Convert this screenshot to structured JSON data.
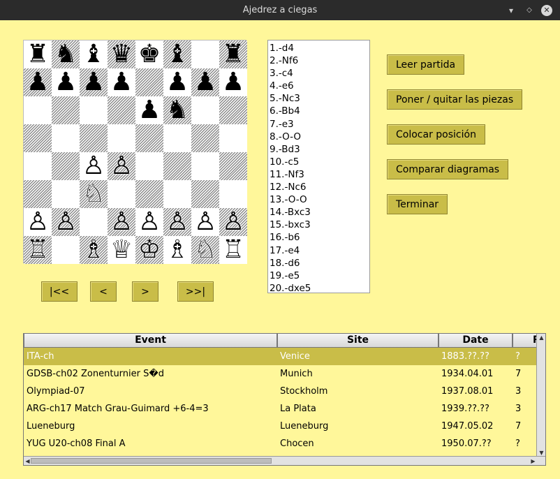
{
  "window": {
    "title": "Ajedrez a ciegas"
  },
  "board": [
    [
      "♜",
      "♞",
      "♝",
      "♛",
      "♚",
      "♝",
      "",
      "♜"
    ],
    [
      "♟",
      "♟",
      "♟",
      "♟",
      "",
      "♟",
      "♟",
      "♟"
    ],
    [
      "",
      "",
      "",
      "",
      "♟",
      "♞",
      "",
      ""
    ],
    [
      "",
      "",
      "",
      "",
      "",
      "",
      "",
      ""
    ],
    [
      "",
      "",
      "♙",
      "♙",
      "",
      "",
      "",
      ""
    ],
    [
      "",
      "",
      "♘",
      "",
      "",
      "",
      "",
      ""
    ],
    [
      "♙",
      "♙",
      "",
      "♙",
      "♙",
      "♙",
      "♙",
      "♙"
    ],
    [
      "♖",
      "",
      "♗",
      "♕",
      "♔",
      "♗",
      "♘",
      "♖"
    ]
  ],
  "nav": {
    "first": "|<<",
    "prev": "<",
    "next": ">",
    "last": ">>|"
  },
  "moves": [
    "1.-d4",
    "2.-Nf6",
    "3.-c4",
    "4.-e6",
    "5.-Nc3",
    "6.-Bb4",
    "7.-e3",
    "8.-O-O",
    "9.-Bd3",
    "10.-c5",
    "11.-Nf3",
    "12.-Nc6",
    "13.-O-O",
    "14.-Bxc3",
    "15.-bxc3",
    "16.-b6",
    "17.-e4",
    "18.-d6",
    "19.-e5",
    "20.-dxe5"
  ],
  "actions": {
    "read": "Leer partida",
    "toggle_pieces": "Poner / quitar las piezas",
    "set_position": "Colocar posición",
    "compare": "Comparar diagramas",
    "finish": "Terminar"
  },
  "table": {
    "headers": [
      "Event",
      "Site",
      "Date",
      "R"
    ],
    "rows": [
      [
        "ITA-ch",
        "Venice",
        "1883.??.??",
        "?"
      ],
      [
        "GDSB-ch02 Zonenturnier S�d",
        "Munich",
        "1934.04.01",
        "7"
      ],
      [
        "Olympiad-07",
        "Stockholm",
        "1937.08.01",
        "3"
      ],
      [
        "ARG-ch17 Match Grau-Guimard +6-4=3",
        "La Plata",
        "1939.??.??",
        "3"
      ],
      [
        "Lueneburg",
        "Lueneburg",
        "1947.05.02",
        "7"
      ],
      [
        "YUG U20-ch08 Final A",
        "Chocen",
        "1950.07.??",
        "?"
      ]
    ],
    "selected_row": 0
  },
  "colors": {
    "background": "#fff79a",
    "button": "#c9bd48",
    "titlebar": "#2b2b2b"
  }
}
